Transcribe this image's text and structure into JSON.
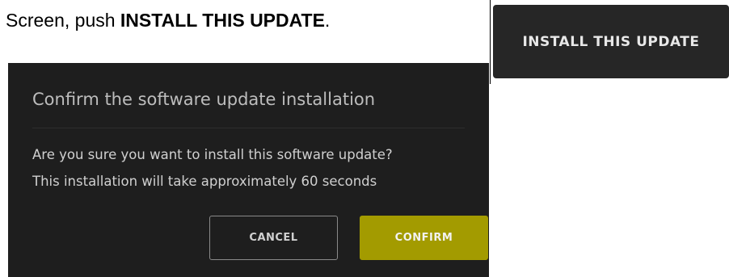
{
  "instruction": {
    "prefix": "Screen, push ",
    "emphasis": "INSTALL THIS UPDATE",
    "suffix": "."
  },
  "install_button": {
    "label": "INSTALL THIS UPDATE"
  },
  "dialog": {
    "title": "Confirm the software update installation",
    "message_line1": "Are you sure you want to install this software update?",
    "message_line2": "This installation will take approximately 60 seconds",
    "cancel_label": "CANCEL",
    "confirm_label": "CONFIRM"
  },
  "colors": {
    "dialog_background": "#1e1e1e",
    "install_button_background": "#262626",
    "confirm_accent": "#a39b00"
  }
}
